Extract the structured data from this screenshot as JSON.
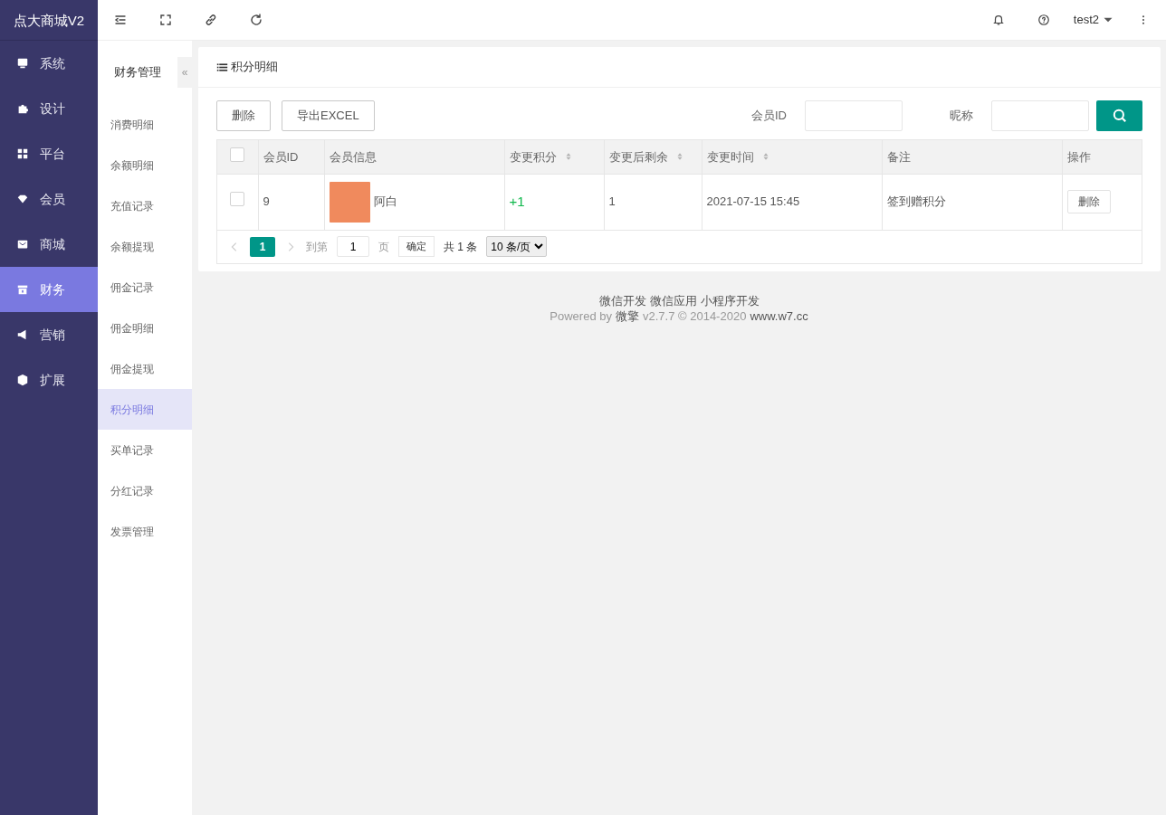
{
  "brand": "点大商城V2",
  "user": {
    "name": "test2"
  },
  "sidebar": {
    "items": [
      {
        "label": "系统",
        "selected": false
      },
      {
        "label": "设计",
        "selected": false
      },
      {
        "label": "平台",
        "selected": false
      },
      {
        "label": "会员",
        "selected": false
      },
      {
        "label": "商城",
        "selected": false
      },
      {
        "label": "财务",
        "selected": true
      },
      {
        "label": "营销",
        "selected": false
      },
      {
        "label": "扩展",
        "selected": false
      }
    ]
  },
  "submenu": {
    "title": "财务管理",
    "collapse": "«",
    "items": [
      {
        "label": "消费明细",
        "selected": false
      },
      {
        "label": "余额明细",
        "selected": false
      },
      {
        "label": "充值记录",
        "selected": false
      },
      {
        "label": "余额提现",
        "selected": false
      },
      {
        "label": "佣金记录",
        "selected": false
      },
      {
        "label": "佣金明细",
        "selected": false
      },
      {
        "label": "佣金提现",
        "selected": false
      },
      {
        "label": "积分明细",
        "selected": true
      },
      {
        "label": "买单记录",
        "selected": false
      },
      {
        "label": "分红记录",
        "selected": false
      },
      {
        "label": "发票管理",
        "selected": false
      }
    ]
  },
  "panel": {
    "title": "积分明细",
    "buttons": [
      "删除",
      "导出EXCEL"
    ],
    "filters": [
      {
        "label": "会员ID"
      },
      {
        "label": "昵称"
      }
    ],
    "table": {
      "select_all_checked": false,
      "columns": [
        {
          "label": "会员ID",
          "sortable": false
        },
        {
          "label": "会员信息",
          "sortable": false
        },
        {
          "label": "变更积分",
          "sortable": true
        },
        {
          "label": "变更后剩余",
          "sortable": true
        },
        {
          "label": "变更时间",
          "sortable": true
        },
        {
          "label": "备注",
          "sortable": false
        },
        {
          "label": "操作",
          "sortable": false
        }
      ],
      "rows": [
        {
          "checked": false,
          "id": "9",
          "nickname": "阿白",
          "points": "+1",
          "remaining": "1",
          "time": "2021-07-15 15:45",
          "remark": "签到赠积分",
          "action": "删除"
        }
      ]
    },
    "pagination": {
      "pages": [
        {
          "label": "1",
          "selected": true
        }
      ],
      "goto": "到第",
      "page_value": "1",
      "page_unit": "页",
      "confirm": "确定",
      "total": "共 1 条",
      "page_size": "10 条/页"
    }
  },
  "footer": {
    "links": [
      "微信开发",
      "微信应用",
      "小程序开发"
    ],
    "powered": "Powered by",
    "brand": "微擎",
    "version": "v2.7.7 © 2014-2020",
    "site": "www.w7.cc"
  }
}
